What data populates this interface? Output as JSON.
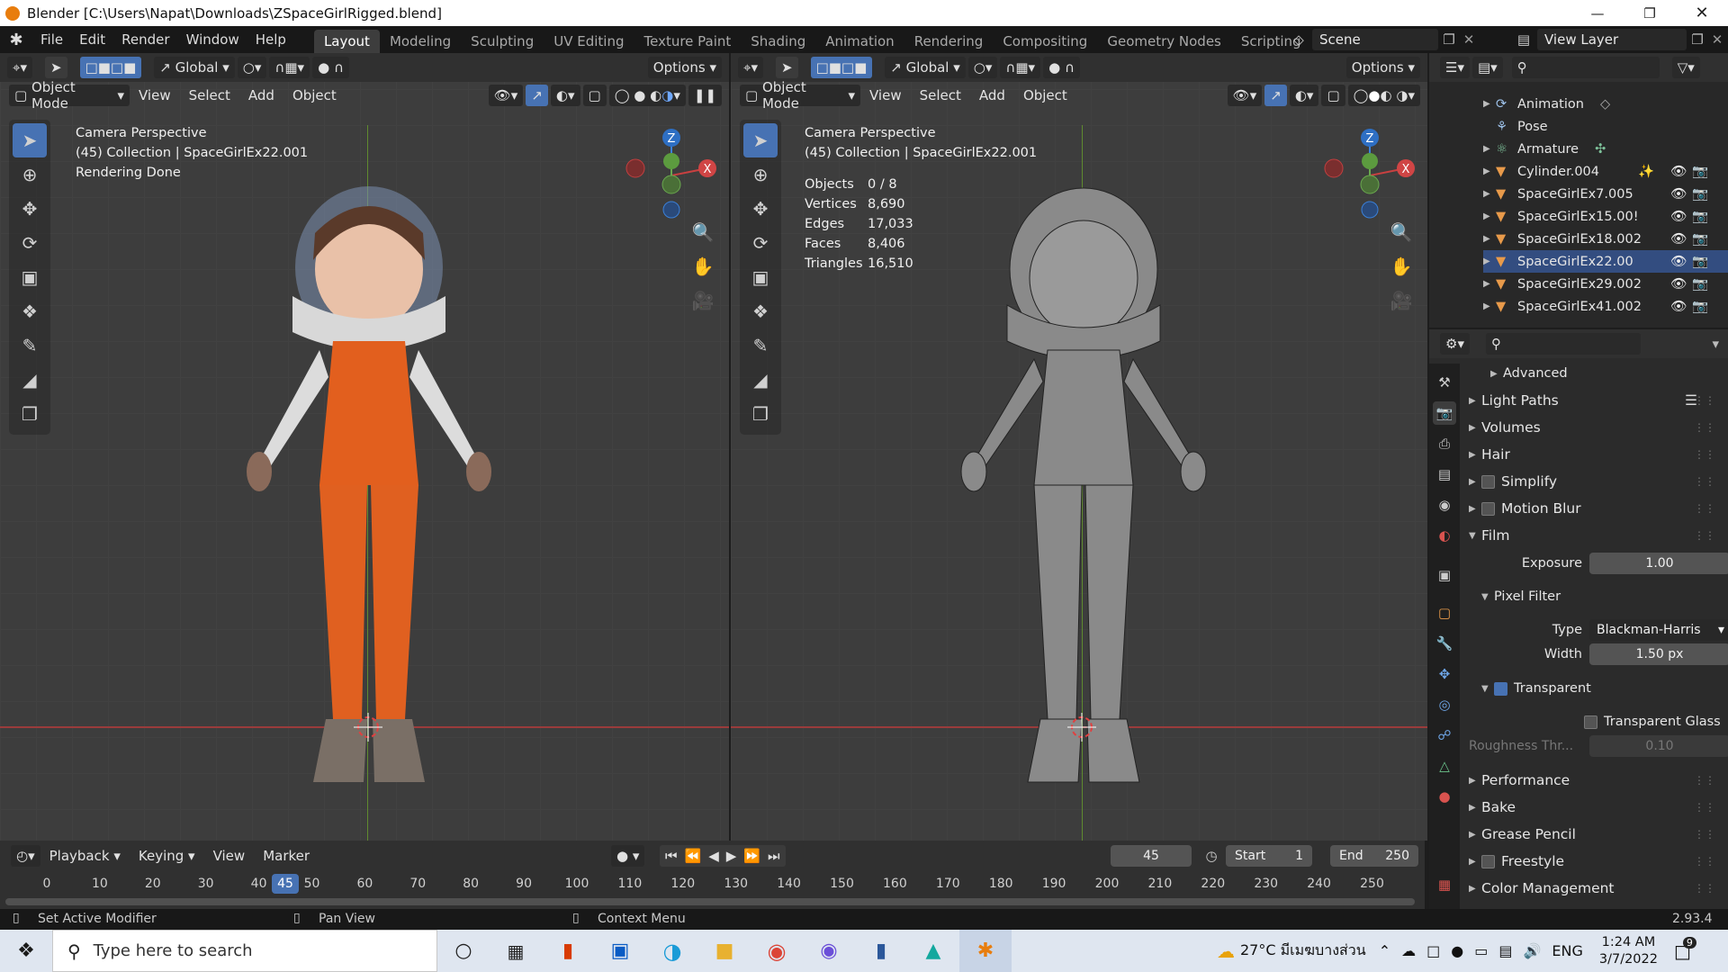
{
  "window": {
    "title": "Blender [C:\\Users\\Napat\\Downloads\\ZSpaceGirlRigged.blend]"
  },
  "menu": [
    "File",
    "Edit",
    "Render",
    "Window",
    "Help"
  ],
  "workspaces": [
    "Layout",
    "Modeling",
    "Sculpting",
    "UV Editing",
    "Texture Paint",
    "Shading",
    "Animation",
    "Rendering",
    "Compositing",
    "Geometry Nodes",
    "Scripting"
  ],
  "scene": {
    "name": "Scene",
    "view_layer": "View Layer"
  },
  "viewport_left": {
    "transform": "Global",
    "options": "Options",
    "mode": "Object Mode",
    "menus": [
      "View",
      "Select",
      "Add",
      "Object"
    ],
    "info": [
      "Camera Perspective",
      "(45) Collection | SpaceGirlEx22.001",
      "Rendering Done"
    ]
  },
  "viewport_right": {
    "transform": "Global",
    "options": "Options",
    "mode": "Object Mode",
    "menus": [
      "View",
      "Select",
      "Add",
      "Object"
    ],
    "info": [
      "Camera Perspective",
      "(45) Collection | SpaceGirlEx22.001"
    ],
    "stats": [
      {
        "label": "Objects",
        "value": "0 / 8"
      },
      {
        "label": "Vertices",
        "value": "8,690"
      },
      {
        "label": "Edges",
        "value": "17,033"
      },
      {
        "label": "Faces",
        "value": "8,406"
      },
      {
        "label": "Triangles",
        "value": "16,510"
      }
    ]
  },
  "gizmo": {
    "z": "Z",
    "y": "Y",
    "x": "X"
  },
  "outliner": {
    "items": [
      {
        "label": "Animation"
      },
      {
        "label": "Pose"
      },
      {
        "label": "Armature"
      },
      {
        "label": "Cylinder.004"
      },
      {
        "label": "SpaceGirlEx7.005"
      },
      {
        "label": "SpaceGirlEx15.00!"
      },
      {
        "label": "SpaceGirlEx18.002"
      },
      {
        "label": "SpaceGirlEx22.00"
      },
      {
        "label": "SpaceGirlEx29.002"
      },
      {
        "label": "SpaceGirlEx41.002"
      }
    ]
  },
  "properties": {
    "sections": {
      "advanced": "Advanced",
      "light_paths": "Light Paths",
      "volumes": "Volumes",
      "hair": "Hair",
      "simplify": "Simplify",
      "motion_blur": "Motion Blur",
      "film": "Film",
      "exposure_label": "Exposure",
      "exposure_value": "1.00",
      "pixel_filter": "Pixel Filter",
      "type_label": "Type",
      "type_value": "Blackman-Harris",
      "width_label": "Width",
      "width_value": "1.50 px",
      "transparent": "Transparent",
      "transparent_glass": "Transparent Glass",
      "roughness_label": "Roughness Thr...",
      "roughness_value": "0.10",
      "performance": "Performance",
      "bake": "Bake",
      "grease_pencil": "Grease Pencil",
      "freestyle": "Freestyle",
      "color_management": "Color Management"
    }
  },
  "timeline": {
    "menus": [
      "Playback",
      "Keying",
      "View",
      "Marker"
    ],
    "current_frame": "45",
    "start_label": "Start",
    "start_value": "1",
    "end_label": "End",
    "end_value": "250",
    "ticks": [
      "0",
      "10",
      "20",
      "30",
      "40",
      "50",
      "60",
      "70",
      "80",
      "90",
      "100",
      "110",
      "120",
      "130",
      "140",
      "150",
      "160",
      "170",
      "180",
      "190",
      "200",
      "210",
      "220",
      "230",
      "240",
      "250"
    ],
    "playhead": "45"
  },
  "statusbar": {
    "left": "Set Active Modifier",
    "middle": "Pan View",
    "right": "Context Menu",
    "version": "2.93.4"
  },
  "taskbar": {
    "search_placeholder": "Type here to search",
    "weather": "27°C  มีเมฆบางส่วน",
    "lang": "ENG",
    "time": "1:24 AM",
    "date": "3/7/2022",
    "notifications": "9"
  }
}
